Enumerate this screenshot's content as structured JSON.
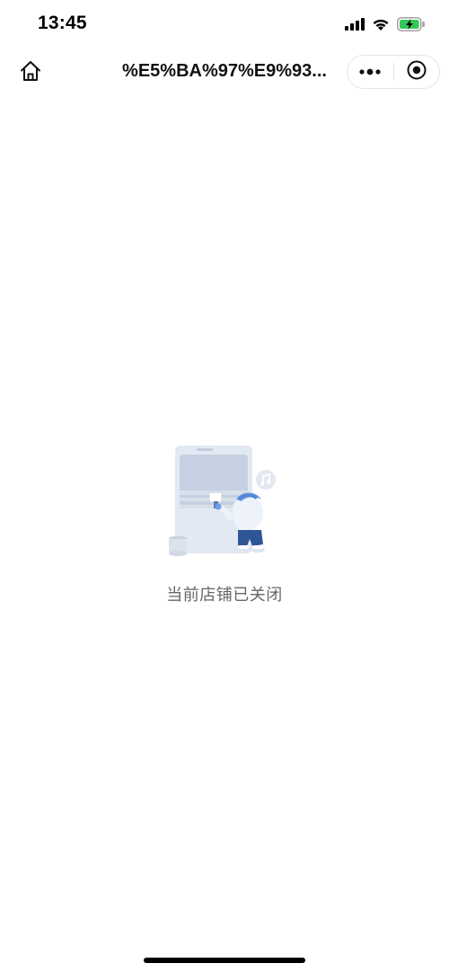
{
  "status_bar": {
    "time": "13:45",
    "icons": [
      "cellular-signal-icon",
      "wifi-icon",
      "battery-charging-icon"
    ],
    "battery_color": "#34c759"
  },
  "nav_bar": {
    "title": "%E5%BA%97%E9%93...",
    "left_icon": "home-icon",
    "capsule_icons": [
      "more-dots-icon",
      "close-miniprogram-icon"
    ]
  },
  "main": {
    "illustration": "shop-closed-illustration",
    "message": "当前店铺已关闭"
  },
  "colors": {
    "illustration_primary": "#c9d6e8",
    "illustration_accent": "#6d9ee8",
    "text_secondary": "#666666"
  }
}
